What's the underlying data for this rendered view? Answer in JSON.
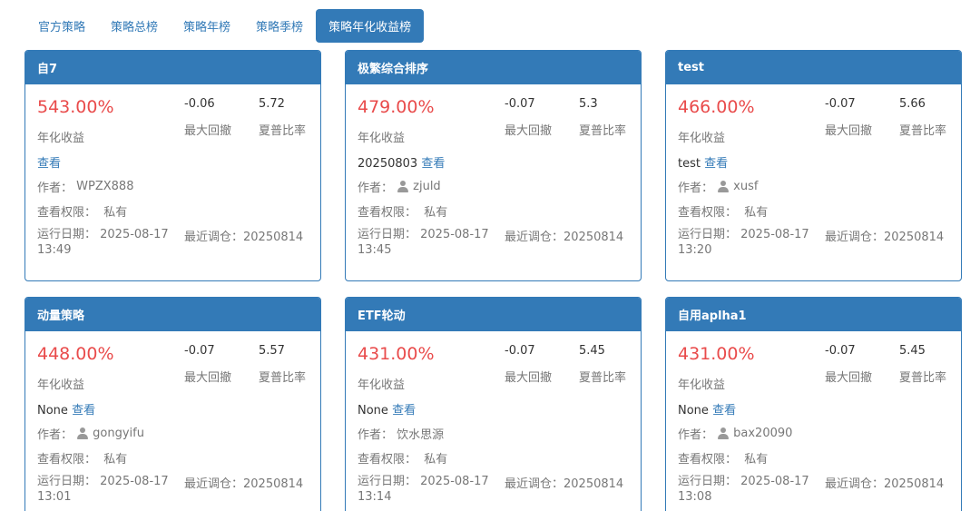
{
  "tabs": [
    "官方策略",
    "策略总榜",
    "策略年榜",
    "策略季榜",
    "策略年化收益榜"
  ],
  "active_tab": 4,
  "labels": {
    "annual_return": "年化收益",
    "max_drawdown": "最大回撤",
    "sharpe": "夏普比率",
    "view": "查看",
    "author_prefix": "作者：",
    "perm_prefix": "查看权限：",
    "run_date_prefix": "运行日期：",
    "rebalance_prefix": "最近调仓："
  },
  "cards": [
    {
      "title": "自7",
      "return": "543.00%",
      "drawdown": "-0.06",
      "sharpe": "5.72",
      "desc": "",
      "author": "WPZX888",
      "author_icon": false,
      "permission": "私有",
      "run_date": "2025-08-17 13:49",
      "rebalance": "20250814"
    },
    {
      "title": "极繁综合排序",
      "return": "479.00%",
      "drawdown": "-0.07",
      "sharpe": "5.3",
      "desc": "20250803",
      "author": "zjuld",
      "author_icon": true,
      "permission": "私有",
      "run_date": "2025-08-17 13:45",
      "rebalance": "20250814"
    },
    {
      "title": "test",
      "return": "466.00%",
      "drawdown": "-0.07",
      "sharpe": "5.66",
      "desc": "test",
      "author": "xusf",
      "author_icon": true,
      "permission": "私有",
      "run_date": "2025-08-17 13:20",
      "rebalance": "20250814"
    },
    {
      "title": "动量策略",
      "return": "448.00%",
      "drawdown": "-0.07",
      "sharpe": "5.57",
      "desc": "None",
      "author": "gongyifu",
      "author_icon": true,
      "permission": "私有",
      "run_date": "2025-08-17 13:01",
      "rebalance": "20250814"
    },
    {
      "title": "ETF轮动",
      "return": "431.00%",
      "drawdown": "-0.07",
      "sharpe": "5.45",
      "desc": "None",
      "author": "饮水思源",
      "author_icon": false,
      "permission": "私有",
      "run_date": "2025-08-17 13:14",
      "rebalance": "20250814"
    },
    {
      "title": "自用aplha1",
      "return": "431.00%",
      "drawdown": "-0.07",
      "sharpe": "5.45",
      "desc": "None",
      "author": "bax20090",
      "author_icon": true,
      "permission": "私有",
      "run_date": "2025-08-17 13:08",
      "rebalance": "20250814"
    }
  ],
  "colors": {
    "primary": "#337ab7",
    "return_red": "#e94b4b",
    "muted": "#777777"
  }
}
